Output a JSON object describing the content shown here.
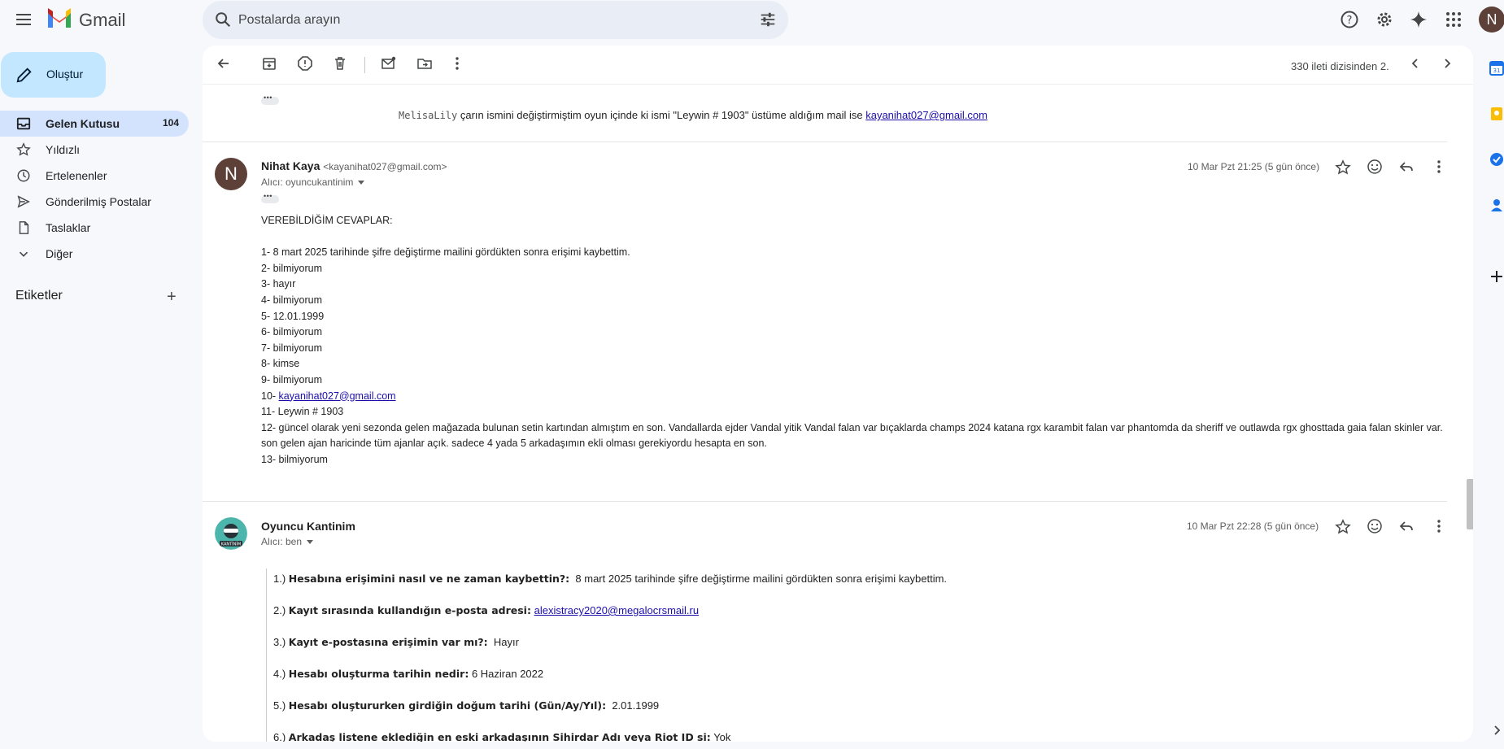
{
  "app": {
    "name": "Gmail",
    "avatar_letter": "N"
  },
  "search": {
    "placeholder": "Postalarda arayın"
  },
  "compose": {
    "label": "Oluştur"
  },
  "nav": [
    {
      "label": "Gelen Kutusu",
      "count": "104",
      "icon": "inbox-icon"
    },
    {
      "label": "Yıldızlı",
      "icon": "star-icon"
    },
    {
      "label": "Ertelenenler",
      "icon": "clock-icon"
    },
    {
      "label": "Gönderilmiş Postalar",
      "icon": "send-icon"
    },
    {
      "label": "Taslaklar",
      "icon": "draft-icon"
    },
    {
      "label": "Diğer",
      "icon": "chevron-down-icon"
    }
  ],
  "labels": {
    "heading": "Etiketler"
  },
  "toolbar": {
    "pager": "330 ileti dizisinden 2."
  },
  "quoted": {
    "mono_part": "MelisaLily",
    "text": " çarın ismini değiştirmiştim oyun içinde ki ismi \"Leywin # 1903\" üstüme aldığım mail ise ",
    "link": "kayanihat027@gmail.com"
  },
  "message1": {
    "avatar_letter": "N",
    "sender": "Nihat Kaya",
    "sender_email": "<kayanihat027@gmail.com>",
    "recipient": "Alıcı: oyuncukantinim",
    "date": "10 Mar Pzt 21:25 (5 gün önce)",
    "heading": "VEREBİLDİĞİM CEVAPLAR:",
    "lines": [
      "1- 8 mart 2025 tarihinde şifre değiştirme mailini gördükten sonra erişimi kaybettim.",
      "2- bilmiyorum",
      "3- hayır",
      "4- bilmiyorum",
      "5- 12.01.1999",
      "6- bilmiyorum",
      "7- bilmiyorum",
      "8- kimse",
      "9- bilmiyorum"
    ],
    "line10_prefix": "10- ",
    "line10_link": "kayanihat027@gmail.com",
    "line11": "11- Leywin # 1903",
    "line12": "12- güncel olarak yeni sezonda gelen mağazada bulunan setin kartından almıştım en son. Vandallarda ejder Vandal yitik Vandal falan var bıçaklarda champs 2024 katana rgx karambit falan var phantomda da sheriff ve outlawda rgx ghosttada gaia falan skinler var. son gelen ajan haricinde tüm ajanlar açık. sadece 4 yada 5 arkadaşımın ekli olması gerekiyordu hesapta en son.",
    "line13": "13- bilmiyorum"
  },
  "message2": {
    "sender": "Oyuncu Kantinim",
    "recipient": "Alıcı: ben",
    "date": "10 Mar Pzt 22:28 (5 gün önce)",
    "avatar_text": "KANTİNİM",
    "qa": [
      {
        "num": "1.)",
        "q": "Hesabına erişimini nasıl ve ne zaman kaybettin?:",
        "a": "8 mart 2025 tarihinde şifre değiştirme mailini gördükten sonra erişimi kaybettim."
      },
      {
        "num": "2.)",
        "q": "Kayıt sırasında kullandığın e-posta adresi:",
        "a_link": "alexistracy2020@megalocrsmail.ru"
      },
      {
        "num": "3.)",
        "q": "Kayıt e-postasına erişimin var mı?:",
        "a": "Hayır"
      },
      {
        "num": "4.)",
        "q": "Hesabı oluşturma tarihin nedir:",
        "a": "6 Haziran 2022"
      },
      {
        "num": "5.)",
        "q": "Hesabı oluştururken girdiğin doğum tarihi (Gün/Ay/Yıl):",
        "a": "2.01.1999"
      },
      {
        "num": "6.)",
        "q": "Arkadaş listene eklediğin en eski arkadaşının Sihirdar Adı veya Riot ID si:",
        "a": "Yok"
      }
    ]
  }
}
